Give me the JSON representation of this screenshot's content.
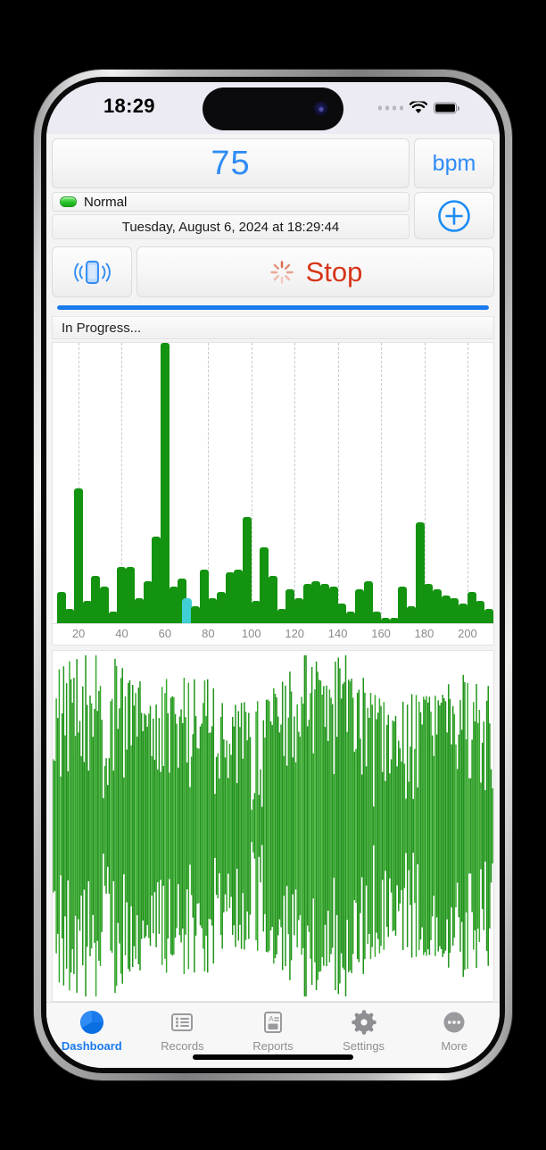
{
  "status_bar": {
    "time": "18:29",
    "cellular_icon": "cellular-dots-icon",
    "wifi_icon": "wifi-icon",
    "battery_icon": "battery-full-icon"
  },
  "readout": {
    "value": "75",
    "unit": "bpm",
    "add_icon": "plus-circle-icon"
  },
  "status": {
    "indicator_label": "Normal",
    "indicator_color": "#27c427",
    "datetime": "Tuesday, August 6, 2024 at 18:29:44"
  },
  "controls": {
    "vibrate_icon": "phone-vibrate-icon",
    "stop_label": "Stop",
    "stop_color": "#d63417",
    "spinner_icon": "activity-spinner-icon"
  },
  "progress": {
    "label": "In Progress...",
    "percent": 100,
    "fill_color": "#1a7aed"
  },
  "tabs": [
    {
      "label": "Dashboard",
      "icon": "pie-chart-icon",
      "active": true
    },
    {
      "label": "Records",
      "icon": "list-document-icon",
      "active": false
    },
    {
      "label": "Reports",
      "icon": "report-page-icon",
      "active": false
    },
    {
      "label": "Settings",
      "icon": "gear-icon",
      "active": false
    },
    {
      "label": "More",
      "icon": "ellipsis-circle-icon",
      "active": false
    }
  ],
  "chart_data": [
    {
      "type": "bar",
      "name": "beat-interval-histogram",
      "title": "",
      "xlabel": "",
      "ylabel": "",
      "xlim": [
        8,
        212
      ],
      "ylim": [
        0,
        100
      ],
      "grid": true,
      "tick_labels": [
        "20",
        "40",
        "60",
        "80",
        "100",
        "120",
        "140",
        "160",
        "180",
        "200"
      ],
      "ticks": [
        20,
        40,
        60,
        80,
        100,
        120,
        140,
        160,
        180,
        200
      ],
      "bar_color": "#13930f",
      "highlight_color": "#3fcfd5",
      "highlight_x": 70,
      "x": [
        12,
        16,
        20,
        24,
        28,
        32,
        36,
        40,
        44,
        48,
        52,
        56,
        60,
        64,
        68,
        70,
        74,
        78,
        82,
        86,
        90,
        94,
        98,
        102,
        106,
        110,
        114,
        118,
        122,
        126,
        130,
        134,
        138,
        142,
        146,
        150,
        154,
        158,
        162,
        166,
        170,
        174,
        178,
        182,
        186,
        190,
        194,
        198,
        202,
        206,
        210
      ],
      "values": [
        11,
        5,
        48,
        8,
        17,
        13,
        4,
        20,
        20,
        9,
        15,
        31,
        100,
        13,
        16,
        9,
        6,
        19,
        9,
        11,
        18,
        19,
        38,
        8,
        27,
        17,
        5,
        12,
        9,
        14,
        15,
        14,
        13,
        7,
        4,
        12,
        15,
        4,
        2,
        2,
        13,
        6,
        36,
        14,
        12,
        10,
        9,
        7,
        11,
        8,
        5
      ]
    },
    {
      "type": "line",
      "name": "pulse-waveform",
      "title": "",
      "xlabel": "",
      "ylabel": "",
      "description": "Dense symmetric vertical-spike pulse waveform, green, centered baseline",
      "line_color": "#1e9418",
      "sample_count": 300,
      "amplitude_range": [
        0.12,
        1.0
      ]
    }
  ]
}
